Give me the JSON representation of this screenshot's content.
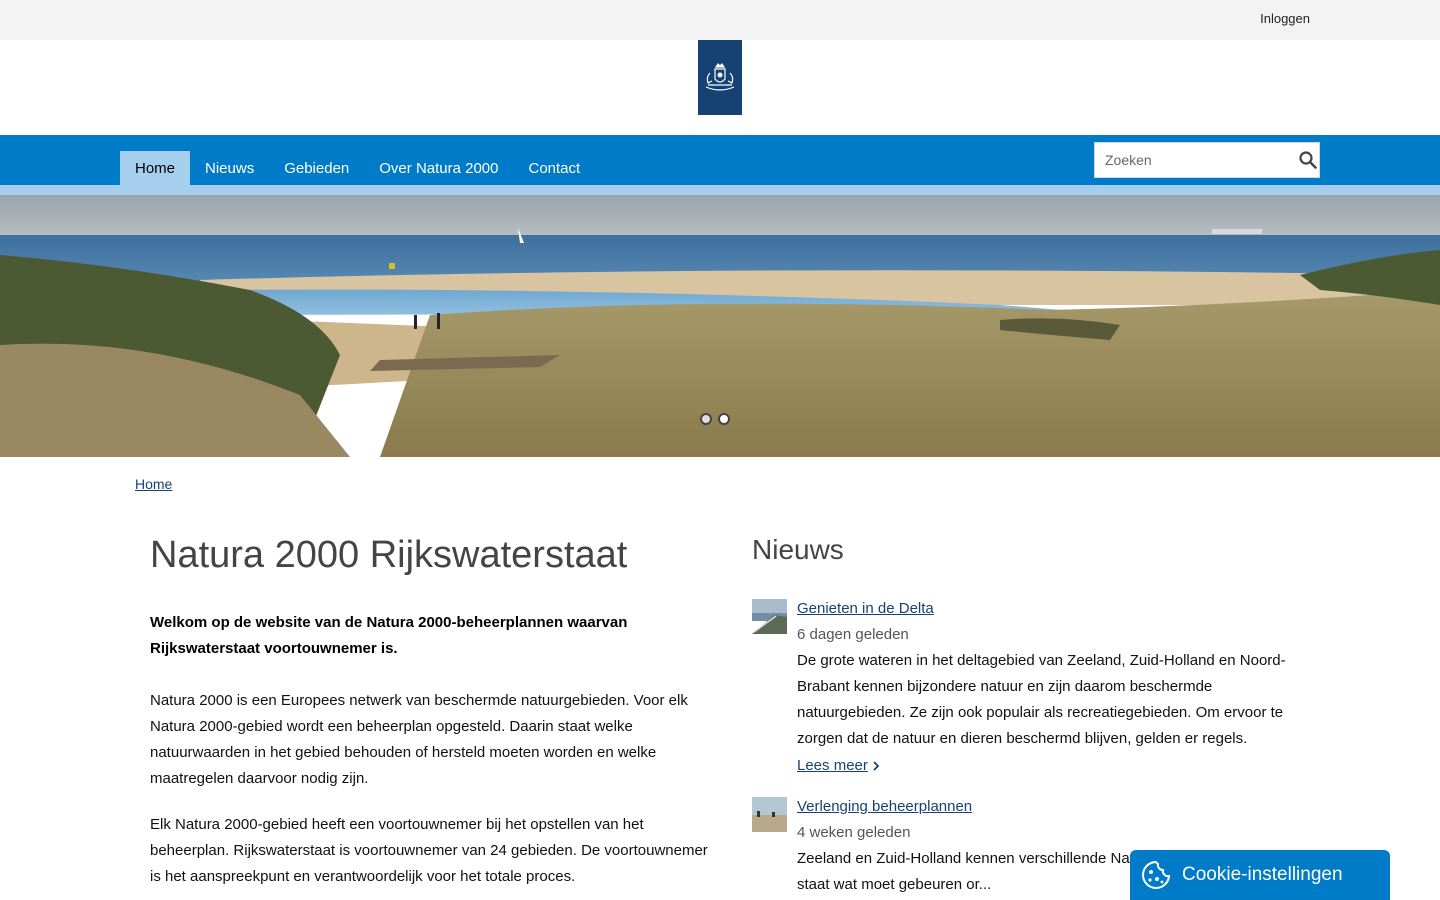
{
  "topbar": {
    "login_label": "Inloggen"
  },
  "logo": {
    "icon": "rijksoverheid-coat-of-arms-icon"
  },
  "nav": {
    "items": [
      {
        "label": "Home",
        "active": true
      },
      {
        "label": "Nieuws",
        "active": false
      },
      {
        "label": "Gebieden",
        "active": false
      },
      {
        "label": "Over Natura 2000",
        "active": false
      },
      {
        "label": "Contact",
        "active": false
      }
    ]
  },
  "search": {
    "placeholder": "Zoeken",
    "icon": "search-icon"
  },
  "hero": {
    "slides": 2,
    "active_slide": 1
  },
  "breadcrumb": {
    "home_label": "Home"
  },
  "main": {
    "title": "Natura 2000 Rijkswaterstaat",
    "intro": "Welkom op de website van de Natura 2000-beheerplannen waarvan Rijkswaterstaat voortouwnemer is.",
    "paragraphs": [
      "Natura 2000 is een Europees netwerk van beschermde natuurgebieden. Voor elk Natura 2000-gebied wordt een beheerplan opgesteld. Daarin staat welke natuurwaarden in het gebied behouden of hersteld moeten worden en welke maatregelen daarvoor nodig zijn.",
      "Elk Natura 2000-gebied heeft een voortouwnemer bij het opstellen van het beheerplan. Rijkswaterstaat is voortouwnemer van 24 gebieden. De voortouwnemer is het aanspreekpunt en verantwoordelijk voor het totale proces."
    ]
  },
  "news": {
    "heading": "Nieuws",
    "items": [
      {
        "title": "Genieten in de Delta",
        "date": "6 dagen geleden",
        "description": "De grote wateren in het deltagebied van Zeeland, Zuid-Holland en Noord-Brabant kennen bijzondere natuur en zijn daarom beschermde natuurgebieden. Ze zijn ook populair als recreatiegebieden. Om ervoor te zorgen dat de natuur en dieren beschermd blijven, gelden er regels.",
        "read_more": "Lees meer"
      },
      {
        "title": "Verlenging beheerplannen",
        "date": "4 weken geleden",
        "description": "Zeeland en Zuid-Holland kennen verschillende Nat... beheerplannen. Hierin staat wat moet gebeuren or..."
      }
    ]
  },
  "cookie": {
    "label": "Cookie-instellingen",
    "icon": "cookie-icon"
  },
  "colors": {
    "brand_blue": "#007bc7",
    "nav_light": "#a6cfee",
    "logo_blue": "#154273",
    "link": "#154273"
  }
}
